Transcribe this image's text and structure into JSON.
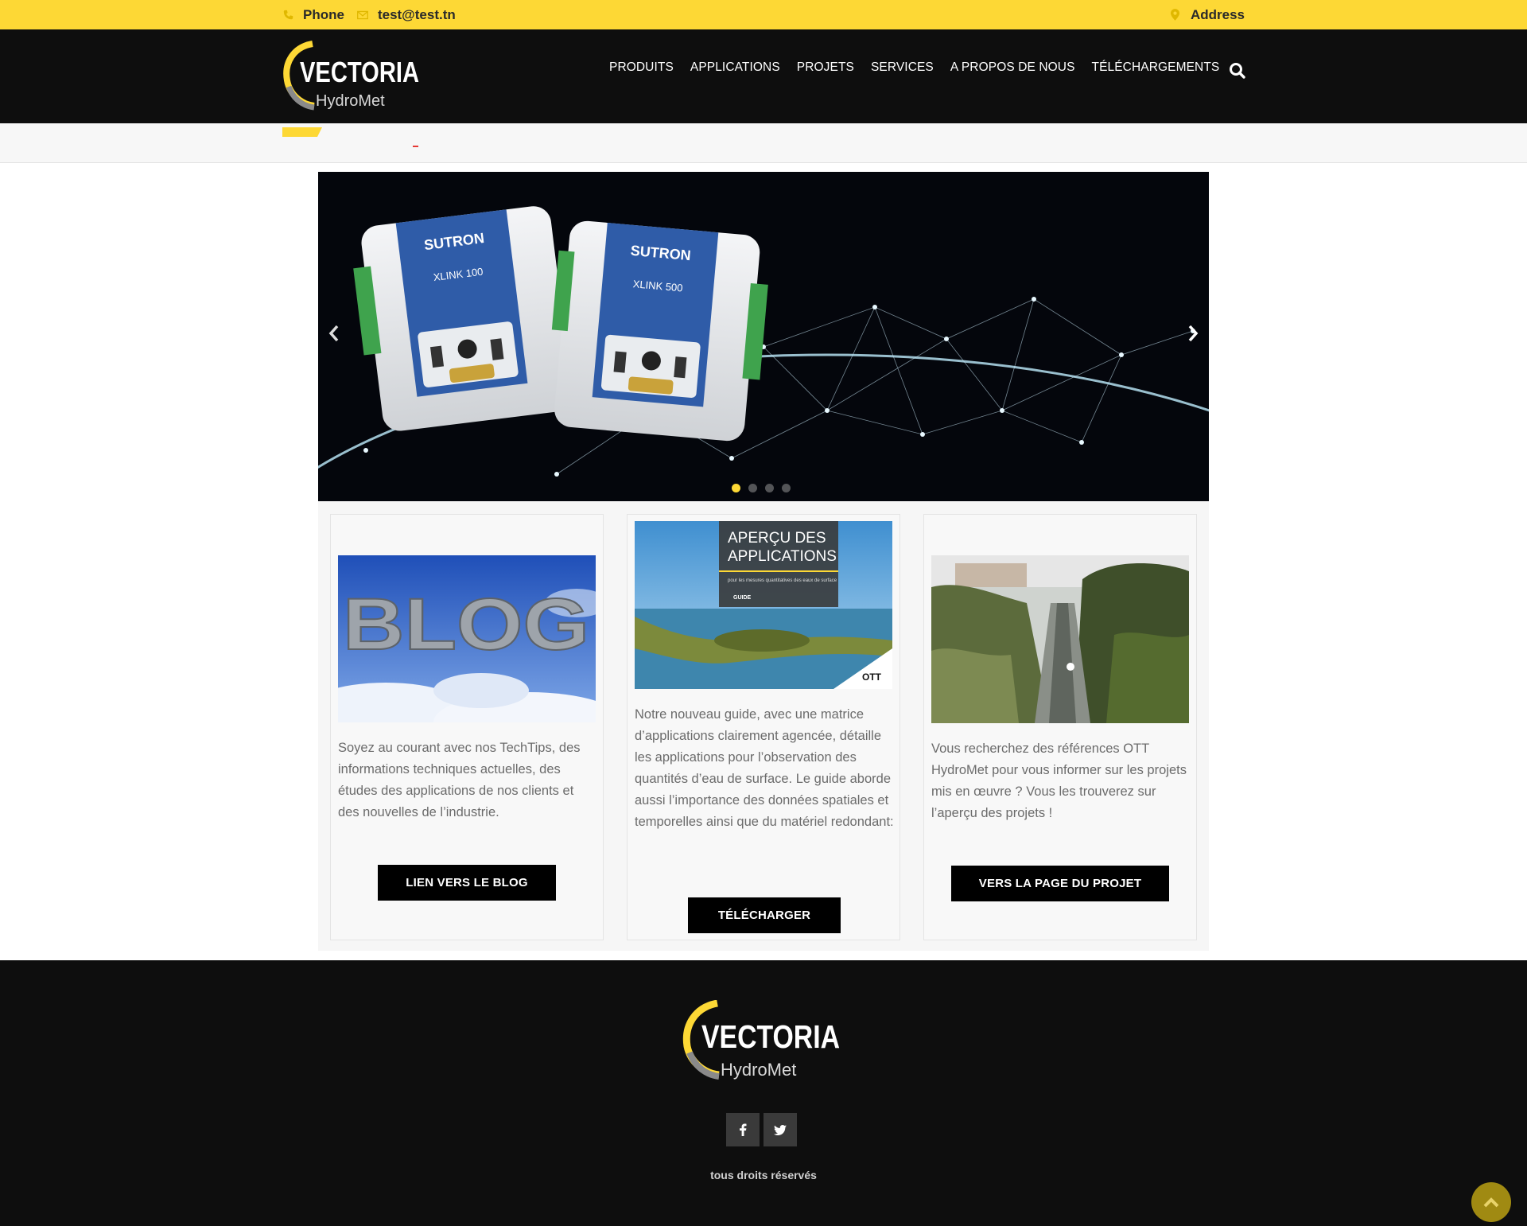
{
  "topbar": {
    "phone_label": "Phone",
    "email_label": "test@test.tn",
    "address_label": "Address",
    "phone_icon": "phone-icon",
    "email_icon": "envelope-icon",
    "address_icon": "map-marker-icon"
  },
  "header": {
    "logo_text": "VECTORIA",
    "logo_subtext": "HydroMet",
    "nav": [
      {
        "label": "PRODUITS"
      },
      {
        "label": "APPLICATIONS"
      },
      {
        "label": "PROJETS"
      },
      {
        "label": "SERVICES"
      },
      {
        "label": "A PROPOS DE NOUS"
      },
      {
        "label": "TÉLÉCHARGEMENTS"
      }
    ],
    "search_icon": "search-icon"
  },
  "slider": {
    "slide_device_brand_1": "SUTRON",
    "slide_device_model_1": "XLINK 100",
    "slide_device_brand_2": "SUTRON",
    "slide_device_model_2": "XLINK 500",
    "active_index": 0,
    "slide_count": 4
  },
  "cards": [
    {
      "image_text": "BLOG",
      "text": "Soyez au courant avec nos TechTips, des informations techniques actuelles, des études des applications de nos clients et des nouvelles de l’industrie.",
      "button": "LIEN VERS LE BLOG"
    },
    {
      "image_title_line1": "APERÇU DES",
      "image_title_line2": "APPLICATIONS",
      "image_subtitle": "pour les mesures quantitatives des eaux de surface",
      "image_tag": "GUIDE",
      "image_brand": "OTT",
      "text": "Notre nouveau guide, avec une matrice d’applications clairement agencée, détaille les applications pour l’observation des quantités d’eau de surface. Le guide aborde aussi l’importance des données spatiales et temporelles ainsi que du matériel redondant:",
      "button": "TÉLÉCHARGER"
    },
    {
      "text": "Vous recherchez des références OTT HydroMet pour vous informer sur les projets mis en œuvre ? Vous les trouverez sur l’aperçu des projets !",
      "button": "VERS LA PAGE DU PROJET"
    }
  ],
  "footer": {
    "logo_text": "VECTORIA",
    "logo_subtext": "HydroMet",
    "social": [
      "facebook-icon",
      "twitter-icon"
    ],
    "copyright": "tous droits réservés"
  },
  "colors": {
    "accent": "#fdd835",
    "dark": "#0e0e0e",
    "button": "#000000"
  }
}
